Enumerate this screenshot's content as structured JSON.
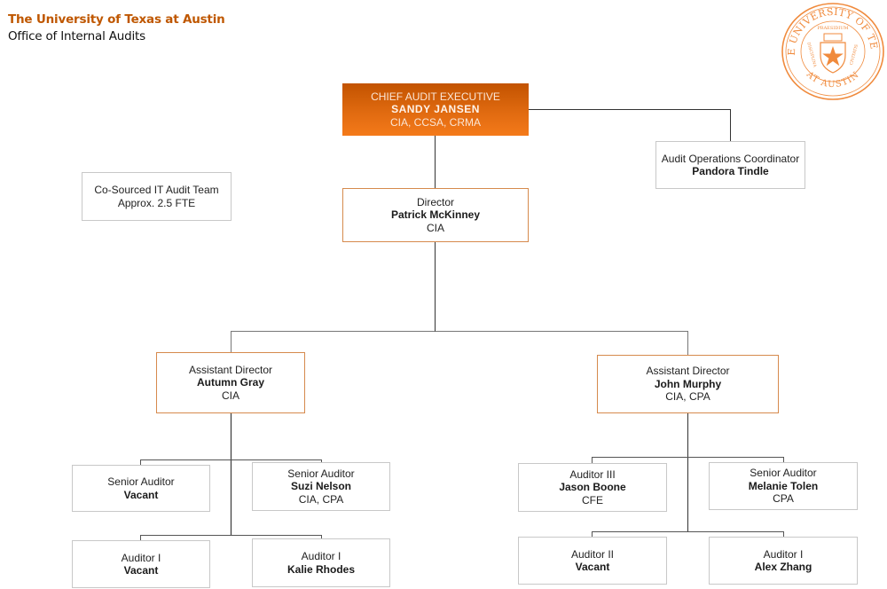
{
  "header": {
    "organization": "The University of Texas at Austin",
    "department": "Office of Internal Audits"
  },
  "seal": {
    "icon": "university-seal-icon",
    "top_text": "THE UNIVERSITY OF TEXAS",
    "bottom_text": "AT AUSTIN",
    "banner_text": "PRAESIDIUM",
    "left_text": "DISCIPLINA",
    "right_text": "CIVITATIS",
    "color": "#f08a3c"
  },
  "colors": {
    "brand_orange": "#bf5700",
    "exec_fill": "#e06a10",
    "manager_border": "#d68a4d",
    "staff_border": "#c8c8c8",
    "connector": "#333333"
  },
  "org_chart": {
    "chief": {
      "title": "CHIEF AUDIT EXECUTIVE",
      "name": "SANDY JANSEN",
      "credentials": "CIA, CCSA, CRMA"
    },
    "coordinator": {
      "title": "Audit Operations Coordinator",
      "name": "Pandora Tindle"
    },
    "it_team": {
      "title": "Co-Sourced IT Audit Team",
      "detail": "Approx. 2.5 FTE"
    },
    "director": {
      "title": "Director",
      "name": "Patrick McKinney",
      "credentials": "CIA"
    },
    "assistant_directors": [
      {
        "title": "Assistant Director",
        "name": "Autumn Gray",
        "credentials": "CIA",
        "reports": [
          {
            "title": "Senior Auditor",
            "name": "Vacant",
            "credentials": ""
          },
          {
            "title": "Senior Auditor",
            "name": "Suzi Nelson",
            "credentials": "CIA, CPA"
          },
          {
            "title": "Auditor I",
            "name": "Vacant",
            "credentials": ""
          },
          {
            "title": "Auditor I",
            "name": "Kalie Rhodes",
            "credentials": ""
          }
        ]
      },
      {
        "title": "Assistant Director",
        "name": "John Murphy",
        "credentials": "CIA, CPA",
        "reports": [
          {
            "title": "Auditor III",
            "name": "Jason Boone",
            "credentials": "CFE"
          },
          {
            "title": "Senior Auditor",
            "name": "Melanie Tolen",
            "credentials": "CPA"
          },
          {
            "title": "Auditor II",
            "name": "Vacant",
            "credentials": ""
          },
          {
            "title": "Auditor I",
            "name": "Alex Zhang",
            "credentials": ""
          }
        ]
      }
    ]
  }
}
